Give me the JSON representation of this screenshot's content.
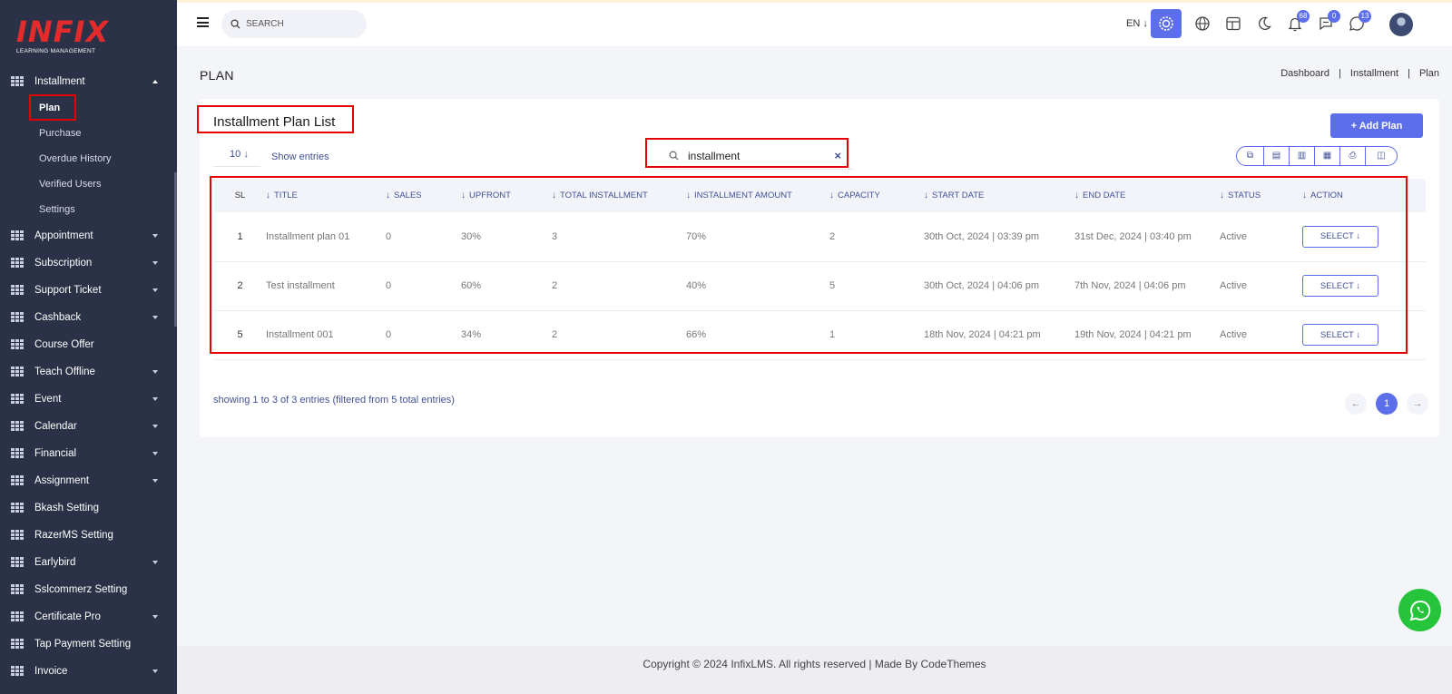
{
  "app": {
    "logo_text": "INFIX",
    "logo_sub": "LEARNING MANAGEMENT"
  },
  "sidebar": {
    "items": [
      {
        "label": "Installment",
        "expanded": true,
        "has_caret": true,
        "children": [
          {
            "label": "Plan",
            "active": true
          },
          {
            "label": "Purchase"
          },
          {
            "label": "Overdue History"
          },
          {
            "label": "Verified Users"
          },
          {
            "label": "Settings"
          }
        ]
      },
      {
        "label": "Appointment",
        "has_caret": true
      },
      {
        "label": "Subscription",
        "has_caret": true
      },
      {
        "label": "Support Ticket",
        "has_caret": true
      },
      {
        "label": "Cashback",
        "has_caret": true
      },
      {
        "label": "Course Offer",
        "has_caret": false
      },
      {
        "label": "Teach Offline",
        "has_caret": true
      },
      {
        "label": "Event",
        "has_caret": true
      },
      {
        "label": "Calendar",
        "has_caret": true
      },
      {
        "label": "Financial",
        "has_caret": true
      },
      {
        "label": "Assignment",
        "has_caret": true
      },
      {
        "label": "Bkash Setting",
        "has_caret": false
      },
      {
        "label": "RazerMS Setting",
        "has_caret": false
      },
      {
        "label": "Earlybird",
        "has_caret": true
      },
      {
        "label": "Sslcommerz Setting",
        "has_caret": false
      },
      {
        "label": "Certificate Pro",
        "has_caret": true
      },
      {
        "label": "Tap Payment Setting",
        "has_caret": false
      },
      {
        "label": "Invoice",
        "has_caret": true
      }
    ]
  },
  "header": {
    "search_placeholder": "SEARCH",
    "language": "EN",
    "notifications_count": "68",
    "messages_count": "0",
    "whatsapp_count": "13",
    "accent": "#5d6eea"
  },
  "page": {
    "title": "PLAN",
    "breadcrumb": [
      "Dashboard",
      "Installment",
      "Plan"
    ]
  },
  "card": {
    "title": "Installment Plan List",
    "add_button": "Add Plan",
    "page_length": "10",
    "show_entries": "Show entries",
    "filter_value": "installment",
    "export_buttons": [
      "copy-icon",
      "csv-icon",
      "excel-icon",
      "pdf-icon",
      "print-icon",
      "columns-icon"
    ]
  },
  "table": {
    "columns": [
      "SL",
      "TITLE",
      "SALES",
      "UPFRONT",
      "TOTAL INSTALLMENT",
      "INSTALLMENT AMOUNT",
      "CAPACITY",
      "START DATE",
      "END DATE",
      "STATUS",
      "ACTION"
    ],
    "rows": [
      {
        "sl": "1",
        "title": "Installment plan 01",
        "sales": "0",
        "upfront": "30%",
        "total": "3",
        "amount": "70%",
        "capacity": "2",
        "start": "30th Oct, 2024 | 03:39 pm",
        "end": "31st Dec, 2024 | 03:40 pm",
        "status": "Active",
        "action": "SELECT"
      },
      {
        "sl": "2",
        "title": "Test installment",
        "sales": "0",
        "upfront": "60%",
        "total": "2",
        "amount": "40%",
        "capacity": "5",
        "start": "30th Oct, 2024 | 04:06 pm",
        "end": "7th Nov, 2024 | 04:06 pm",
        "status": "Active",
        "action": "SELECT"
      },
      {
        "sl": "5",
        "title": "Installment 001",
        "sales": "0",
        "upfront": "34%",
        "total": "2",
        "amount": "66%",
        "capacity": "1",
        "start": "18th Nov, 2024 | 04:21 pm",
        "end": "19th Nov, 2024 | 04:21 pm",
        "status": "Active",
        "action": "SELECT"
      }
    ]
  },
  "pagination": {
    "info": "showing 1 to 3 of 3 entries (filtered from 5 total entries)",
    "current_page": "1"
  },
  "footer": {
    "text": "Copyright © 2024 InfixLMS. All rights reserved | Made By CodeThemes"
  }
}
